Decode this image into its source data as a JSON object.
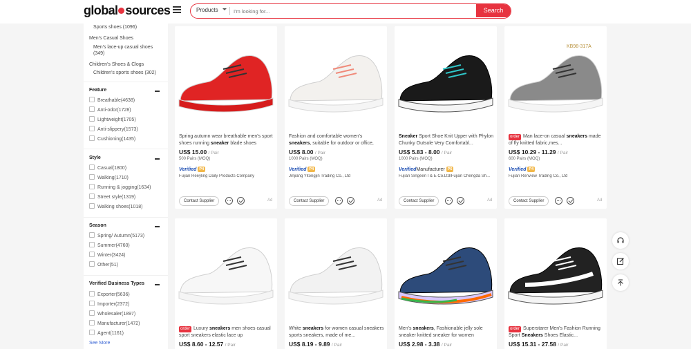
{
  "header": {
    "logo_left": "global",
    "logo_right": "sources",
    "search_category": "Products",
    "search_placeholder": "I'm looking for...",
    "search_button": "Search"
  },
  "sidebar": {
    "top_items": [
      "Sports shoes (1096)",
      "Men's Casual Shoes",
      "Men's lace-up casual shoes (349)",
      "Children's Shoes & Clogs",
      "Children's sports shoes (302)"
    ],
    "sections": [
      {
        "title": "Feature",
        "items": [
          "Breathable(4638)",
          "Anti-odor(1728)",
          "Lightweight(1705)",
          "Anti-slippery(1573)",
          "Cushioning(1435)"
        ]
      },
      {
        "title": "Style",
        "items": [
          "Casual(1800)",
          "Walking(1710)",
          "Running & jogging(1634)",
          "Street style(1319)",
          "Walking shoes(1018)"
        ]
      },
      {
        "title": "Season",
        "items": [
          "Spring/ Autumn(5173)",
          "Summer(4760)",
          "Winter(3424)",
          "Other(51)"
        ]
      },
      {
        "title": "Verified Business Types",
        "items": [
          "Exporter(5636)",
          "Importer(2372)",
          "Wholesaler(1897)",
          "Manufacturer(1472)",
          "Agent(1161)"
        ]
      }
    ],
    "see_more": "See More"
  },
  "products": [
    {
      "order_badge": "",
      "title_pre": "Spring autumn wear breathable men's sport shoes running ",
      "title_bold": "sneaker",
      "title_post": " blade shoes",
      "price": "US$ 15.00",
      "unit": "/ Pair",
      "moq": "500 Pairs (MOQ)",
      "verified": "Verified",
      "manufacturer": "",
      "badge": "P4",
      "supplier": "Fujian Reeyling Daily Products Company",
      "contact": "Contact Supplier",
      "ad": "Ad",
      "shoe_color": "#e02424"
    },
    {
      "order_badge": "",
      "title_pre": "Fashion and comfortable women's ",
      "title_bold": "sneakers",
      "title_post": ", suitable for outdoor or office,",
      "price": "US$ 8.00",
      "unit": "/ Pair",
      "moq": "1000 Pairs (MOQ)",
      "verified": "Verified",
      "manufacturer": "",
      "badge": "P4",
      "supplier": "Jinjiang Yitongjin Trading Co., Ltd",
      "contact": "Contact Supplier",
      "ad": "Ad",
      "shoe_color": "#f3f1ee"
    },
    {
      "order_badge": "",
      "title_pre": "",
      "title_bold": "Sneaker",
      "title_post": " Sport Shoe Knit Upper with Phylon Chunky Outsole Very Comfortabl...",
      "price": "US$ 5.83 - 8.00",
      "unit": "/ Pair",
      "moq": "1000 Pairs (MOQ)",
      "verified": "Verified",
      "manufacturer": "Manufacturer",
      "badge": "P6",
      "supplier": "Fujian Singeen I & E Co.Ltd/Fujian Chengda Sh...",
      "contact": "Contact Supplier",
      "ad": "Ad",
      "shoe_color": "#1a1a1a"
    },
    {
      "order_badge": "order",
      "title_pre": "Man lace-on casual ",
      "title_bold": "sneakers",
      "title_post": " made of fly knitted fabric,mes...",
      "price": "US$ 10.29 - 11.29",
      "unit": "/ Pair",
      "moq": "600 Pairs (MOQ)",
      "verified": "Verified",
      "manufacturer": "",
      "badge": "P4",
      "supplier": "Fujian Renview Trading Co., Ltd",
      "contact": "Contact Supplier",
      "ad": "Ad",
      "shoe_color": "#8a8a8a",
      "image_label": "KB98-317A"
    },
    {
      "order_badge": "order",
      "title_pre": "Luxury ",
      "title_bold": "sneakers",
      "title_post": " men shoes casual sport sneakers elastic lace up",
      "price": "US$ 8.60 - 12.57",
      "unit": "/ Pair",
      "shoe_color": "#f7f7f7"
    },
    {
      "order_badge": "",
      "title_pre": "White ",
      "title_bold": "sneakers",
      "title_post": " for women casual sneakers sports sneakers, made of me...",
      "price": "US$ 8.19 - 9.89",
      "unit": "/ Pair",
      "shoe_color": "#f2f2f2"
    },
    {
      "order_badge": "",
      "title_pre": "Men's ",
      "title_bold": "sneakers",
      "title_post": ", Fashionable jelly sole sneaker knitted sneaker for women",
      "price": "US$ 2.98 - 3.38",
      "unit": "/ Pair",
      "shoe_color": "#2d4b7a"
    },
    {
      "order_badge": "order",
      "title_pre": "Superstarer Men's Fashion Running Sport ",
      "title_bold": "Sneakers",
      "title_post": " Shoes Elastic...",
      "price": "US$ 15.31 - 27.58",
      "unit": "/ Pair",
      "shoe_color": "#222222"
    }
  ]
}
